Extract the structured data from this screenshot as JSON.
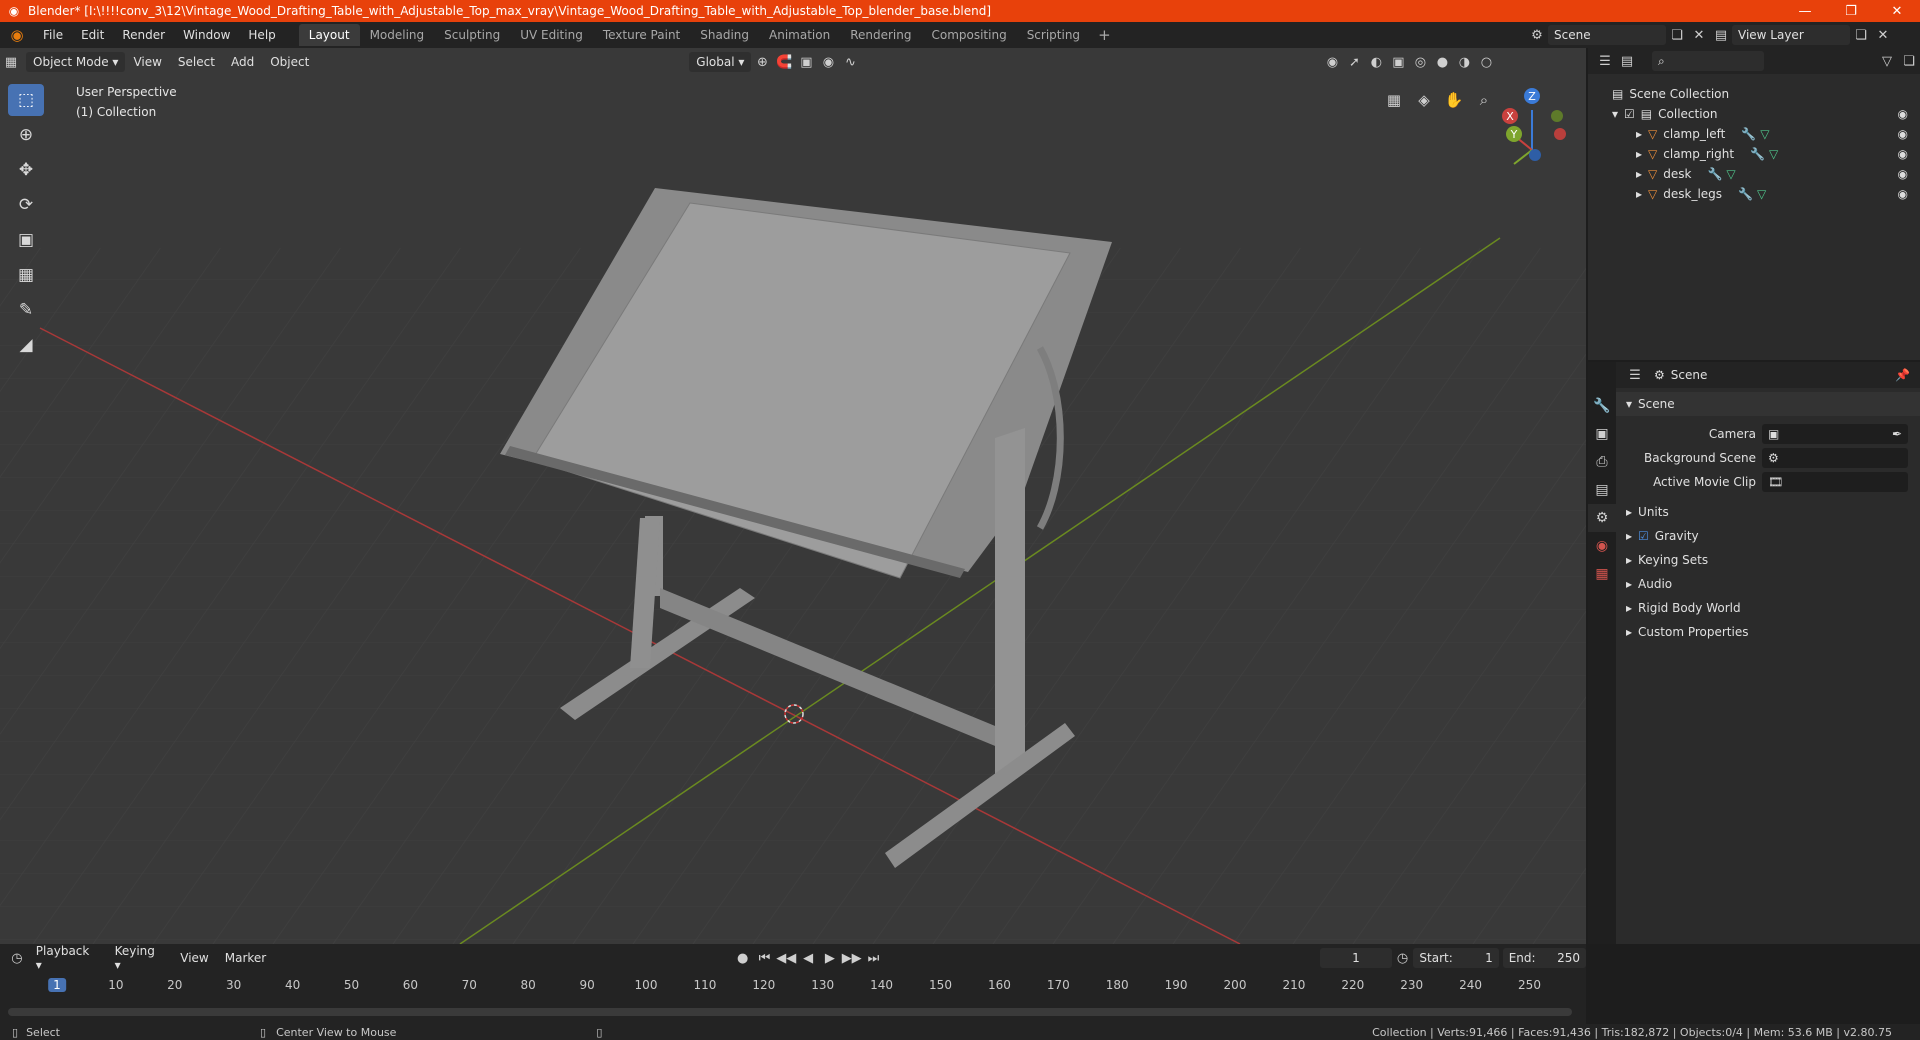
{
  "window": {
    "title": "Blender* [I:\\!!!!conv_3\\12\\Vintage_Wood_Drafting_Table_with_Adjustable_Top_max_vray\\Vintage_Wood_Drafting_Table_with_Adjustable_Top_blender_base.blend]",
    "minimize": "—",
    "maximize": "❐",
    "close": "✕"
  },
  "menubar": {
    "items": [
      "File",
      "Edit",
      "Render",
      "Window",
      "Help"
    ]
  },
  "workspaces": {
    "tabs": [
      "Layout",
      "Modeling",
      "Sculpting",
      "UV Editing",
      "Texture Paint",
      "Shading",
      "Animation",
      "Rendering",
      "Compositing",
      "Scripting"
    ],
    "active": "Layout",
    "add": "+"
  },
  "scene_selector": {
    "scene": "Scene",
    "view_layer": "View Layer"
  },
  "viewport_header": {
    "mode": "Object Mode",
    "menus": [
      "View",
      "Select",
      "Add",
      "Object"
    ],
    "orientation": "Global"
  },
  "viewport": {
    "perspective": "User Perspective",
    "collection": "(1) Collection",
    "gizmo_axes": {
      "x": "X",
      "y": "Y",
      "z": "Z"
    }
  },
  "outliner": {
    "search_placeholder": "",
    "scene_collection": "Scene Collection",
    "collection": "Collection",
    "objects": [
      "clamp_left",
      "clamp_right",
      "desk",
      "desk_legs"
    ]
  },
  "properties": {
    "header": "Scene",
    "panel": "Scene",
    "camera_label": "Camera",
    "background_scene_label": "Background Scene",
    "active_movie_clip_label": "Active Movie Clip",
    "sections": [
      "Units",
      "Gravity",
      "Keying Sets",
      "Audio",
      "Rigid Body World",
      "Custom Properties"
    ]
  },
  "timeline": {
    "menus": [
      "Playback",
      "Keying",
      "View",
      "Marker"
    ],
    "current_frame": "1",
    "start_label": "Start:",
    "start": "1",
    "end_label": "End:",
    "end": "250",
    "ticks": [
      "1",
      "10",
      "20",
      "30",
      "40",
      "50",
      "60",
      "70",
      "80",
      "90",
      "100",
      "110",
      "120",
      "130",
      "140",
      "150",
      "160",
      "170",
      "180",
      "190",
      "200",
      "210",
      "220",
      "230",
      "240",
      "250"
    ]
  },
  "statusbar": {
    "select": "Select",
    "center_view": "Center View to Mouse",
    "stats": "Collection | Verts:91,466 | Faces:91,436 | Tris:182,872 | Objects:0/4 | Mem: 53.6 MB | v2.80.75"
  }
}
